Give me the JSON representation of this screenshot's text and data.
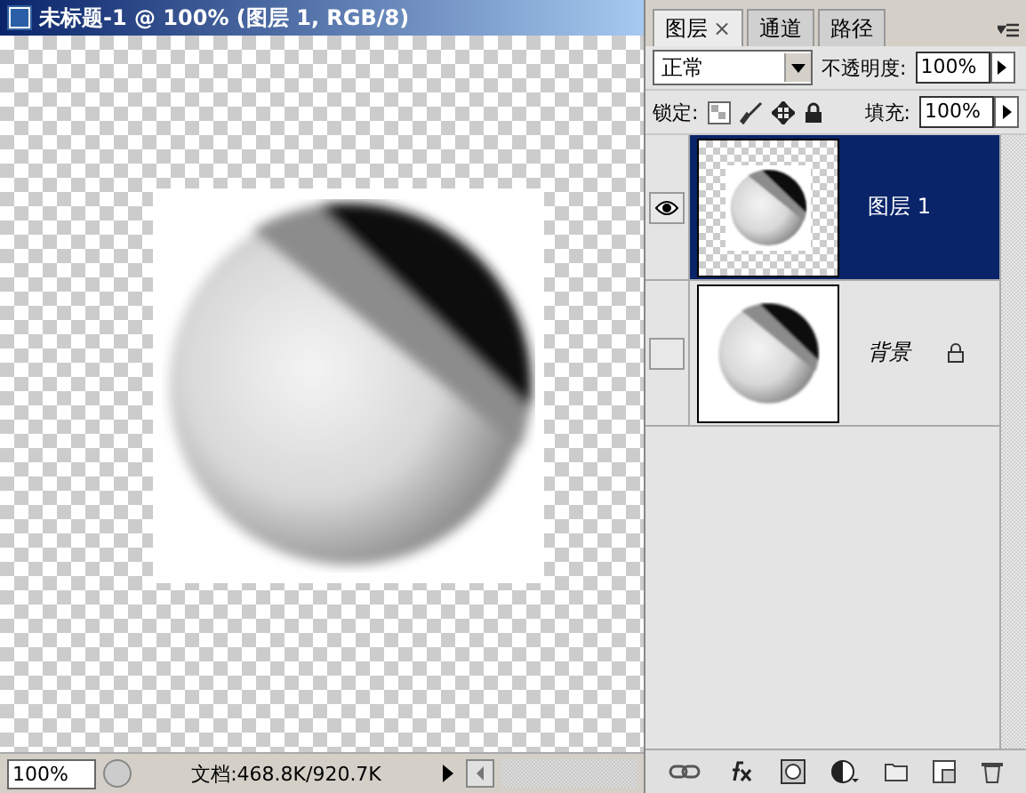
{
  "document": {
    "title": "未标题-1 @ 100% (图层 1, RGB/8)",
    "zoom": "100%",
    "doc_info": "文档:468.8K/920.7K"
  },
  "panel": {
    "tabs": [
      {
        "label": "图层",
        "selected": true,
        "close": "×"
      },
      {
        "label": "通道",
        "selected": false
      },
      {
        "label": "路径",
        "selected": false
      }
    ],
    "blend_mode": "正常",
    "opacity_label": "不透明度:",
    "opacity": "100%",
    "lock_label": "锁定:",
    "fill_label": "填充:",
    "fill": "100%",
    "layers": [
      {
        "name": "图层 1",
        "selected": true,
        "visible": true,
        "transparent": true,
        "locked": false
      },
      {
        "name": "背景",
        "selected": false,
        "visible": false,
        "transparent": false,
        "locked": true
      }
    ]
  }
}
